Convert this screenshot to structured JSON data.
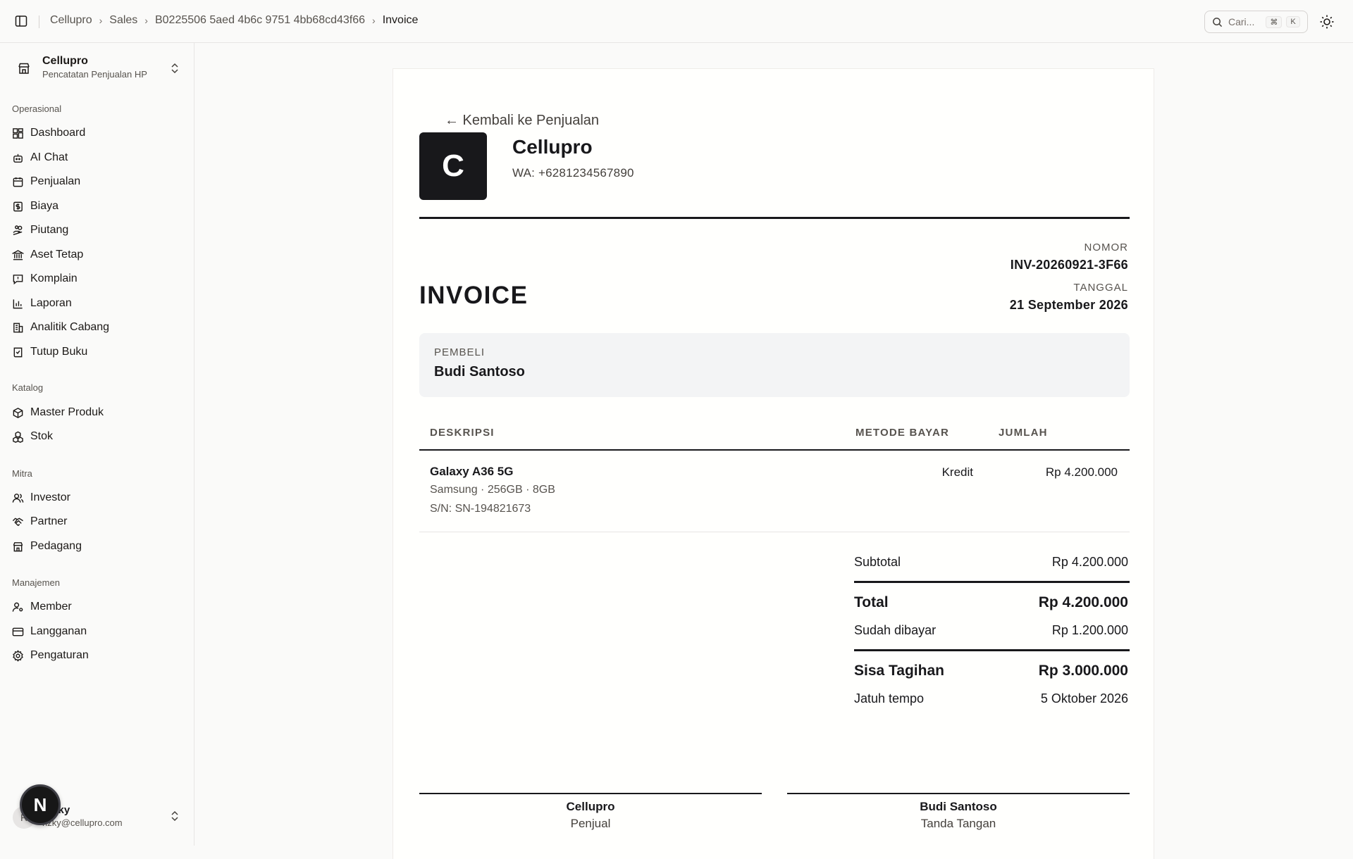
{
  "breadcrumb": [
    "Cellupro",
    "Sales",
    "B0225506 5aed 4b6c 9751 4bb68cd43f66",
    "Invoice"
  ],
  "search": {
    "placeholder": "Cari...",
    "shortcut_mod": "⌘",
    "shortcut_key": "K"
  },
  "org": {
    "name": "Cellupro",
    "subtitle": "Pencatatan Penjualan HP"
  },
  "sidebar": {
    "sections": [
      {
        "title": "Operasional",
        "items": [
          {
            "label": "Dashboard",
            "icon": "dashboard-icon"
          },
          {
            "label": "AI Chat",
            "icon": "bot-icon"
          },
          {
            "label": "Penjualan",
            "icon": "calendar-icon"
          },
          {
            "label": "Biaya",
            "icon": "receipt-icon"
          },
          {
            "label": "Piutang",
            "icon": "hand-coins-icon"
          },
          {
            "label": "Aset Tetap",
            "icon": "landmark-icon"
          },
          {
            "label": "Komplain",
            "icon": "message-alert-icon"
          },
          {
            "label": "Laporan",
            "icon": "bar-chart-icon"
          },
          {
            "label": "Analitik Cabang",
            "icon": "building-icon"
          },
          {
            "label": "Tutup Buku",
            "icon": "book-check-icon"
          }
        ]
      },
      {
        "title": "Katalog",
        "items": [
          {
            "label": "Master Produk",
            "icon": "package-icon"
          },
          {
            "label": "Stok",
            "icon": "boxes-icon"
          }
        ]
      },
      {
        "title": "Mitra",
        "items": [
          {
            "label": "Investor",
            "icon": "users-icon"
          },
          {
            "label": "Partner",
            "icon": "handshake-icon"
          },
          {
            "label": "Pedagang",
            "icon": "store-icon"
          }
        ]
      },
      {
        "title": "Manajemen",
        "items": [
          {
            "label": "Member",
            "icon": "user-cog-icon"
          },
          {
            "label": "Langganan",
            "icon": "credit-card-icon"
          },
          {
            "label": "Pengaturan",
            "icon": "settings-icon"
          }
        ]
      }
    ]
  },
  "user": {
    "initial": "R",
    "name": "Rizky",
    "email": "rizky@cellupro.com"
  },
  "floating_badge": "N",
  "invoice": {
    "back_label": "← Kembali ke Penjualan",
    "logo_letter": "C",
    "shop_name": "Cellupro",
    "shop_wa": "WA: +6281234567890",
    "title": "INVOICE",
    "number_label": "NOMOR",
    "number": "INV-20260921-3F66",
    "date_label": "TANGGAL",
    "date": "21 September 2026",
    "buyer_label": "PEMBELI",
    "buyer_name": "Budi Santoso",
    "columns": [
      "DESKRIPSI",
      "METODE BAYAR",
      "JUMLAH"
    ],
    "items": [
      {
        "name": "Galaxy A36 5G",
        "spec": "Samsung · 256GB · 8GB",
        "serial": "S/N: SN-194821673",
        "method": "Kredit",
        "amount": "Rp 4.200.000"
      }
    ],
    "summary": {
      "subtotal_label": "Subtotal",
      "subtotal": "Rp 4.200.000",
      "total_label": "Total",
      "total": "Rp 4.200.000",
      "paid_label": "Sudah dibayar",
      "paid": "Rp 1.200.000",
      "remaining_label": "Sisa Tagihan",
      "remaining": "Rp 3.000.000",
      "due_label": "Jatuh tempo",
      "due": "5 Oktober 2026"
    },
    "signatures": [
      {
        "name": "Cellupro",
        "role": "Penjual"
      },
      {
        "name": "Budi Santoso",
        "role": "Tanda Tangan"
      }
    ]
  }
}
